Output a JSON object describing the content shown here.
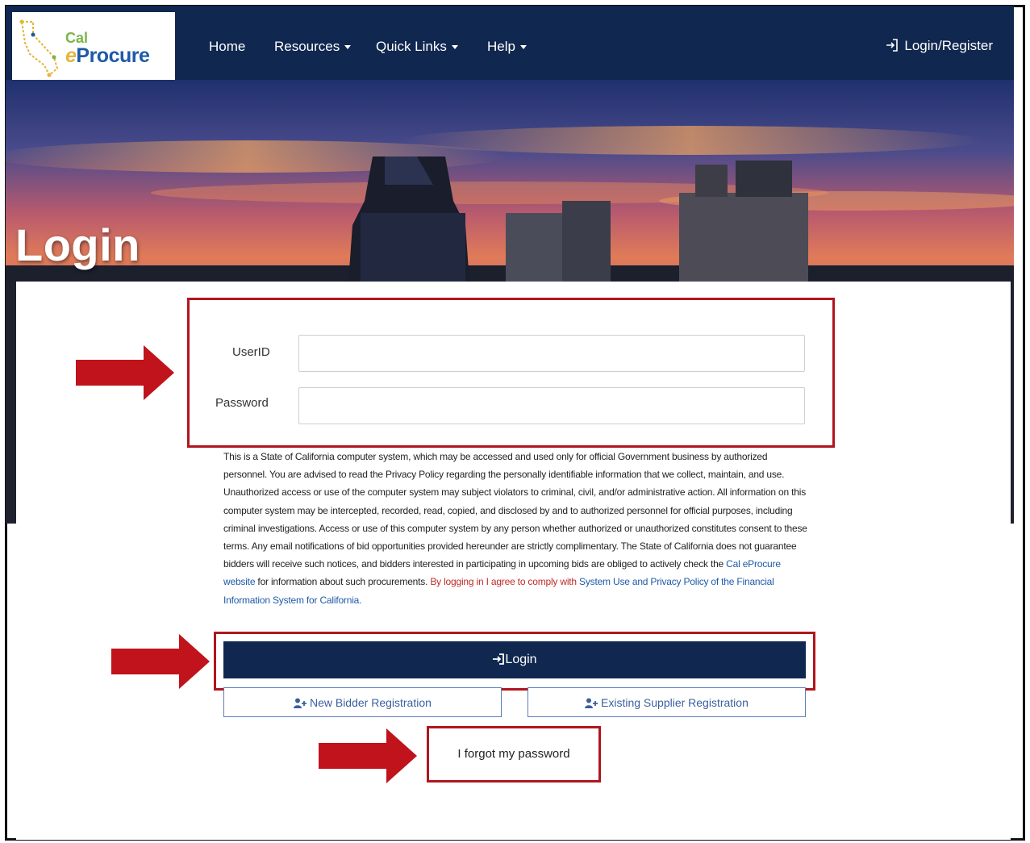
{
  "brand": {
    "line1": "Cal",
    "line2_prefix": "e",
    "line2": "Procure"
  },
  "nav": {
    "home": "Home",
    "resources": "Resources",
    "quick_links": "Quick Links",
    "help": "Help",
    "login_register": "Login/Register"
  },
  "hero": {
    "title": "Login"
  },
  "form": {
    "userid_label": "UserID",
    "userid_value": "",
    "password_label": "Password",
    "password_value": ""
  },
  "disclaimer": {
    "text": "This is a State of California computer system, which may be accessed and used only for official Government business by authorized personnel. You are advised to read the Privacy Policy regarding the personally identifiable information that we collect, maintain, and use. Unauthorized access or use of the computer system may subject violators to criminal, civil, and/or administrative action. All information on this computer system may be intercepted, recorded, read, copied, and disclosed by and to authorized personnel for official purposes, including criminal investigations. Access or use of this computer system by any person whether authorized or unauthorized constitutes consent to these terms. Any email notifications of bid opportunities provided hereunder are strictly complimentary. The State of California does not guarantee bidders will receive such notices, and bidders interested in participating in upcoming bids are obliged to actively check the ",
    "link_website": "Cal eProcure website",
    "text_after_link": " for information about such procurements. ",
    "agree_text": "By logging in I agree to comply with ",
    "link_policy": "System Use and Privacy Policy of the Financial Information System for California."
  },
  "buttons": {
    "login": "Login",
    "new_bidder": "New Bidder Registration",
    "existing_supplier": "Existing Supplier Registration",
    "forgot_password": "I forgot my password"
  },
  "colors": {
    "navy": "#10274f",
    "annotation_red": "#b0161e",
    "link_blue": "#1e5aa8",
    "link_red": "#c02a2a"
  }
}
